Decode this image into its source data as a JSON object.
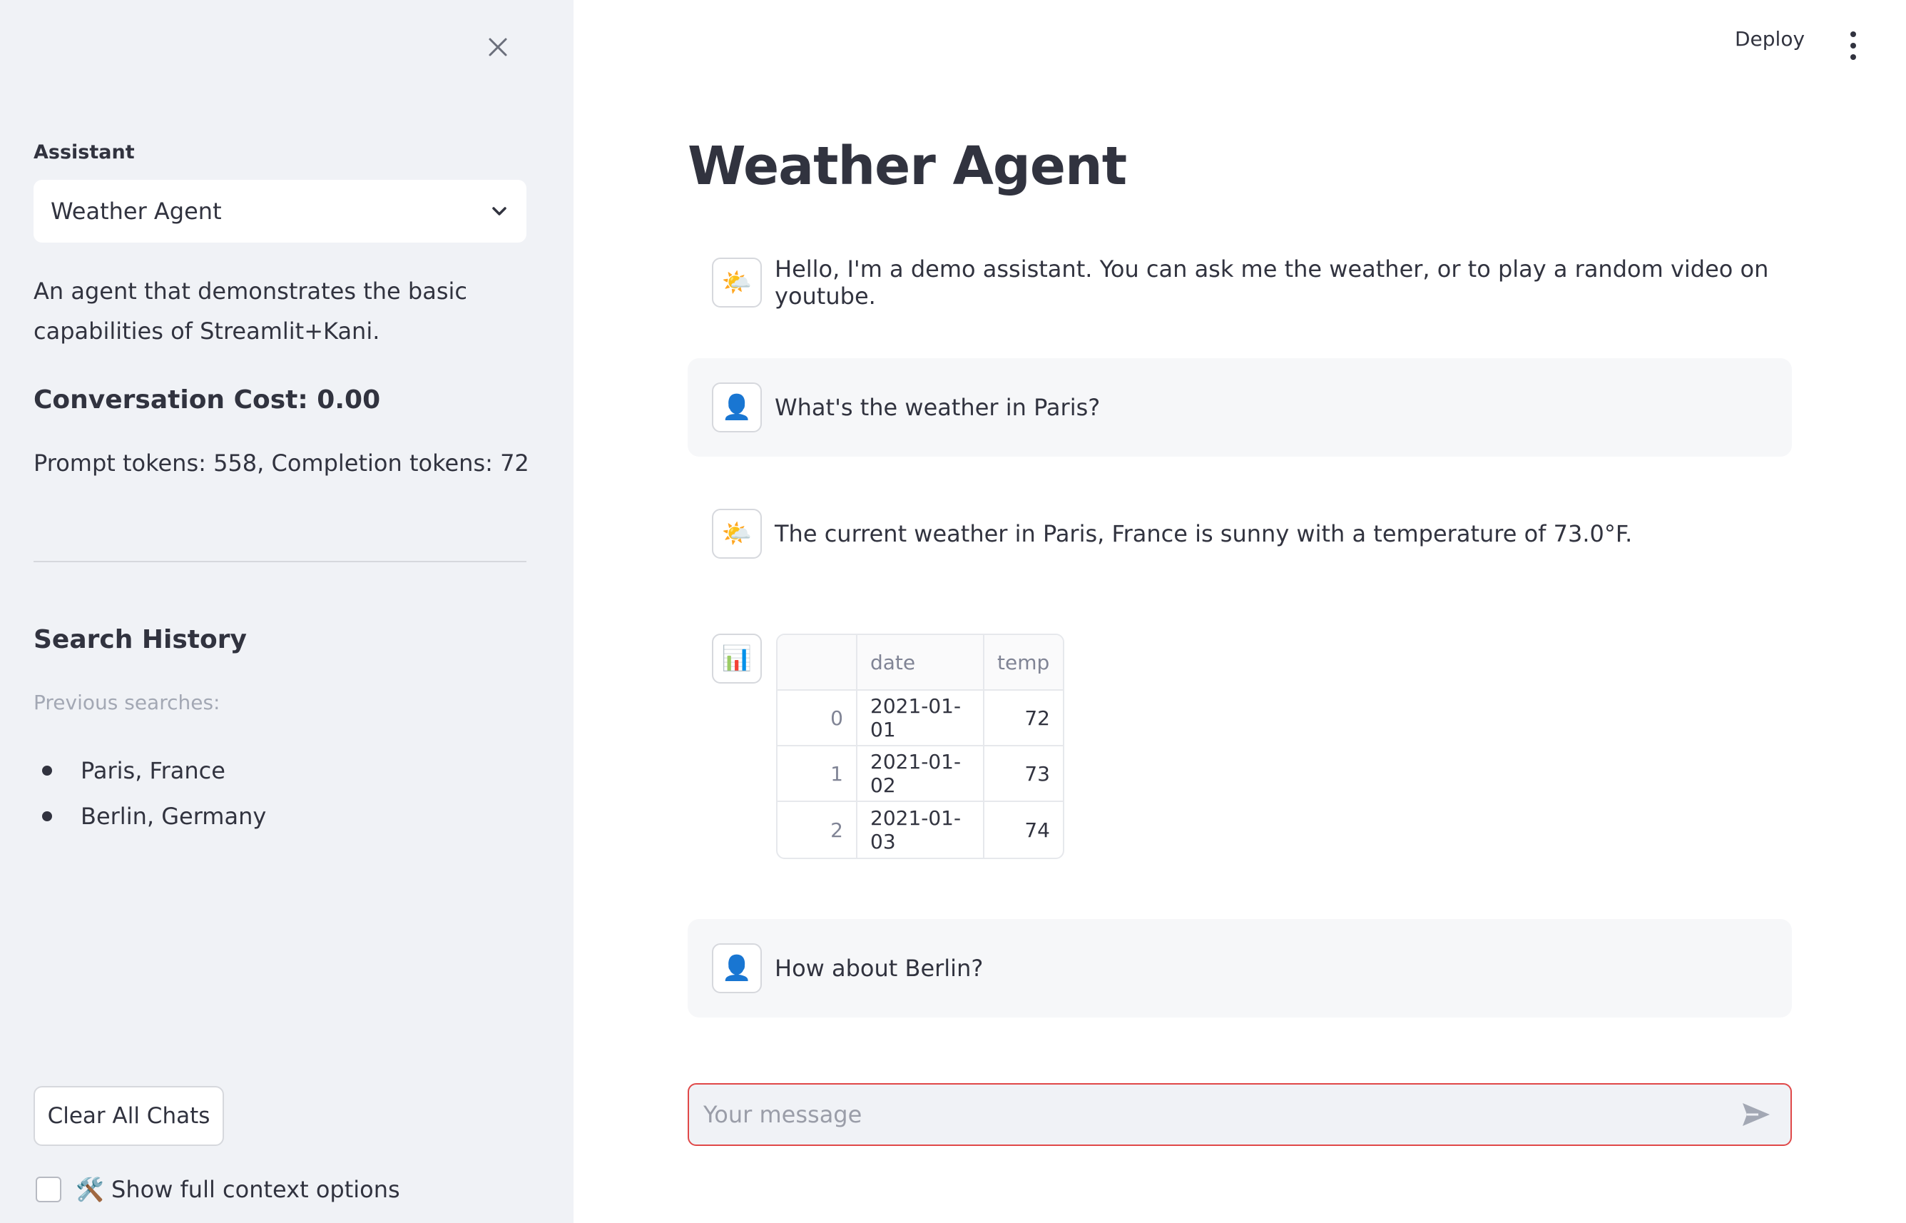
{
  "sidebar": {
    "assistant_label": "Assistant",
    "assistant_selected": "Weather Agent",
    "description": "An agent that demonstrates the basic capabilities of Streamlit+Kani.",
    "cost": "Conversation Cost: 0.00",
    "tokens": "Prompt tokens: 558, Completion tokens: 72",
    "history_title": "Search History",
    "previous_label": "Previous searches:",
    "history": [
      "Paris, France",
      "Berlin, Germany"
    ],
    "clear_button": "Clear All Chats",
    "context_checkbox": "🛠️ Show full context options"
  },
  "topbar": {
    "deploy": "Deploy"
  },
  "main": {
    "title": "Weather Agent",
    "messages": [
      {
        "role": "assistant",
        "icon": "sun-behind-cloud-icon",
        "text": "Hello, I'm a demo assistant. You can ask me the weather, or to play a random video on youtube."
      },
      {
        "role": "user",
        "icon": "user-icon",
        "text": "What's the weather in Paris?"
      },
      {
        "role": "assistant",
        "icon": "sun-behind-cloud-icon",
        "text": "The current weather in Paris, France is sunny with a temperature of 73.0°F."
      },
      {
        "role": "assistant",
        "icon": "bar-chart-icon",
        "table": true
      },
      {
        "role": "user",
        "icon": "user-icon",
        "text": "How about Berlin?"
      }
    ],
    "table": {
      "columns": [
        "",
        "date",
        "temp"
      ],
      "rows": [
        {
          "index": "0",
          "date": "2021-01-01",
          "temp": "72"
        },
        {
          "index": "1",
          "date": "2021-01-02",
          "temp": "73"
        },
        {
          "index": "2",
          "date": "2021-01-03",
          "temp": "74"
        }
      ]
    },
    "input_placeholder": "Your message"
  },
  "colors": {
    "sidebar_bg": "#F0F2F6",
    "text": "#31333F",
    "input_border": "#E04848",
    "user_bubble": "#F6F7F9"
  }
}
